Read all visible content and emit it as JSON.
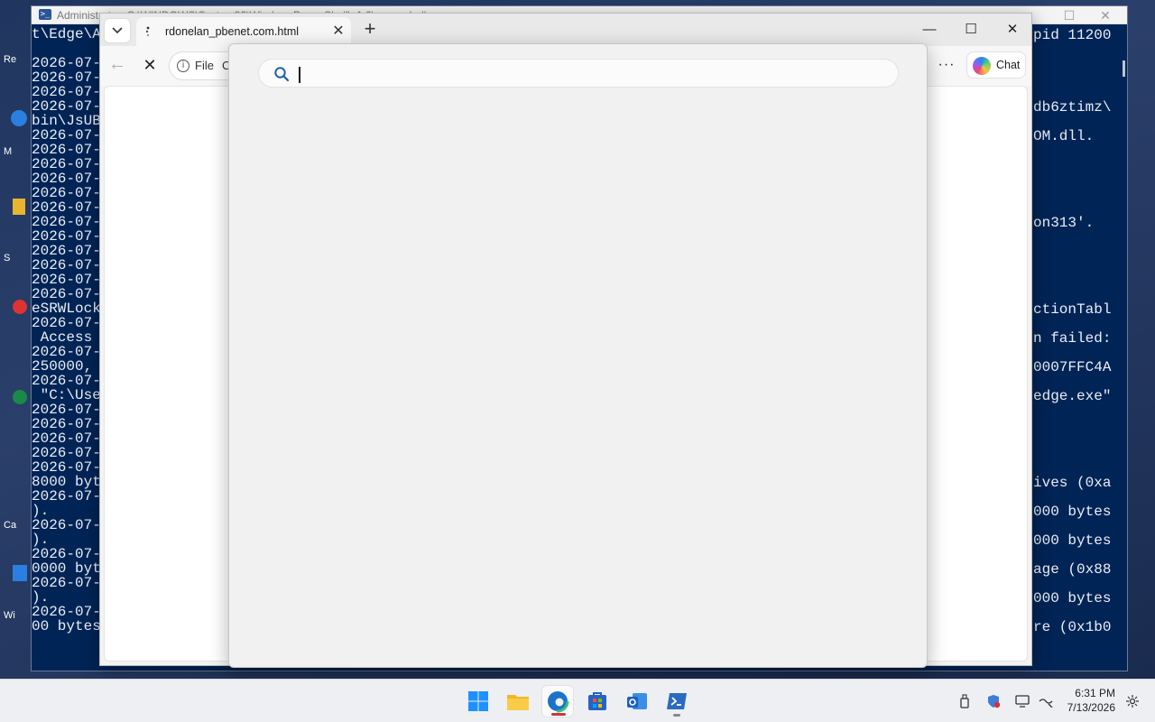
{
  "powershell": {
    "title": "Administrator: C:\\WINDOWS\\System32\\WindowsPowerShell\\v1.0\\powershell.exe",
    "left_lines": [
      "t\\Edge\\A",
      "",
      "2026-07-",
      "2026-07-",
      "2026-07-",
      "2026-07-",
      "bin\\JsUB",
      "2026-07-",
      "2026-07-",
      "2026-07-",
      "2026-07-",
      "2026-07-",
      "2026-07-",
      "2026-07-",
      "2026-07-",
      "2026-07-",
      "2026-07-",
      "2026-07-",
      "2026-07-",
      "eSRWLock",
      "2026-07-",
      " Access ",
      "2026-07-",
      "250000, ",
      "2026-07-",
      " \"C:\\Use",
      "2026-07-",
      "2026-07-",
      "2026-07-",
      "2026-07-",
      "2026-07-",
      "8000 byt",
      "2026-07-",
      ").",
      "2026-07-",
      ").",
      "2026-07-",
      "0000 byt",
      "2026-07-",
      ").",
      "2026-07-",
      "00 bytes"
    ],
    "right_fragments": [
      {
        "text": "pid 11200",
        "row": 0
      },
      {
        "text": "db6ztimz\\",
        "row": 5
      },
      {
        "text": "OM.dll.",
        "row": 7
      },
      {
        "text": "on313'.",
        "row": 13
      },
      {
        "text": "ctionTabl",
        "row": 19
      },
      {
        "text": "n failed:",
        "row": 21
      },
      {
        "text": "0007FFC4A",
        "row": 23
      },
      {
        "text": "edge.exe\"",
        "row": 25
      },
      {
        "text": "ives (0xa",
        "row": 31
      },
      {
        "text": "000 bytes",
        "row": 33
      },
      {
        "text": "000 bytes",
        "row": 35
      },
      {
        "text": "age (0x88",
        "row": 37
      },
      {
        "text": "000 bytes",
        "row": 39
      },
      {
        "text": "re (0x1b0",
        "row": 41
      }
    ]
  },
  "desktop": {
    "labels": [
      "Re",
      "M",
      "S",
      "Ca",
      "Wi"
    ]
  },
  "edge": {
    "tab_title": "rdonelan_pbenet.com.html",
    "address_prefix": "File",
    "address_fragment": "C",
    "chat_label": "Chat",
    "window_controls": {
      "minimize": "—",
      "maximize": "☐",
      "close": "✕"
    }
  },
  "search_popup": {
    "input_value": "",
    "placeholder": ""
  },
  "taskbar": {
    "apps": [
      {
        "name": "start",
        "active": false
      },
      {
        "name": "file-explorer",
        "active": false
      },
      {
        "name": "edge",
        "active": true
      },
      {
        "name": "store",
        "active": false
      },
      {
        "name": "outlook",
        "active": false
      },
      {
        "name": "powershell",
        "active": false
      }
    ],
    "time": "6:31 PM",
    "date": "7/13/2026"
  }
}
